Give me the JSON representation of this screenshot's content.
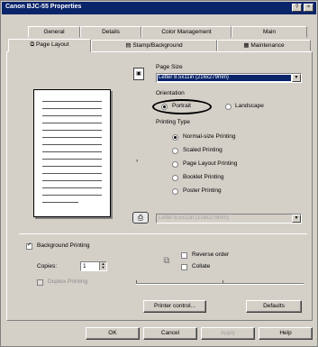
{
  "window": {
    "title": "Canon BJC-55 Properties",
    "buttons": {
      "help": "?",
      "close": "×"
    }
  },
  "tabs_back": [
    "General",
    "Details",
    "Color Management",
    "Main"
  ],
  "tabs_front": [
    "Page Layout",
    "Stamp/Background",
    "Maintenance"
  ],
  "page_layout": {
    "page_size_label": "Page Size",
    "page_size_value": "Letter 8.5x11in (216x279mm)",
    "orientation_label": "Orientation",
    "orientation_options": [
      "Portrait",
      "Landscape"
    ],
    "orientation_selected": "Portrait",
    "printing_type_label": "Printing Type",
    "printing_types": [
      "Normal-size Printing",
      "Scaled Printing",
      "Page Layout Printing",
      "Booklet Printing",
      "Poster Printing"
    ],
    "printing_type_selected": "Normal-size Printing",
    "paper_dropdown_value": "Letter 8.5x11in (216x279mm)",
    "background_printing_label": "Background Printing",
    "background_printing_checked": true,
    "copies_label": "Copies:",
    "copies_value": "1",
    "duplex_label": "Duplex Printing",
    "reverse_order_label": "Reverse order",
    "collate_label": "Collate"
  },
  "buttons": {
    "printer_control": "Printer control...",
    "defaults": "Defaults",
    "ok": "OK",
    "cancel": "Cancel",
    "apply": "Apply",
    "help": "Help"
  },
  "icons": {
    "page_size": "page-size-icon",
    "printer": "printer-icon",
    "collate": "collate-icon"
  }
}
